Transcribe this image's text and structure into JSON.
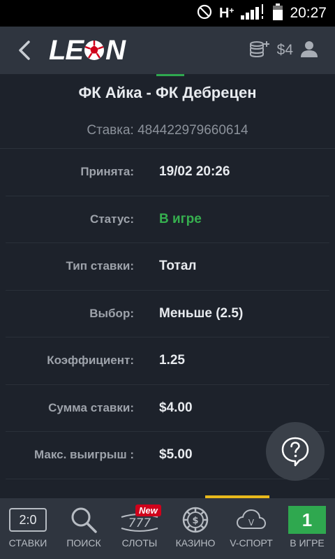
{
  "status_bar": {
    "network": "H",
    "network_plus": "+",
    "time": "20:27"
  },
  "header": {
    "logo_text_left": "LE",
    "logo_text_right": "N",
    "balance": "$4"
  },
  "match": {
    "title": "ФК Айка - ФК Дебрецен",
    "bet_label": "Ставка:",
    "bet_number": "484422979660614"
  },
  "details": [
    {
      "label": "Принята:",
      "value": "19/02 20:26",
      "status": "normal"
    },
    {
      "label": "Статус:",
      "value": "В игре",
      "status": "active"
    },
    {
      "label": "Тип ставки:",
      "value": "Тотал",
      "status": "normal"
    },
    {
      "label": "Выбор:",
      "value": "Меньше (2.5)",
      "status": "normal"
    },
    {
      "label": "Коэффициент:",
      "value": "1.25",
      "status": "normal"
    },
    {
      "label": "Сумма ставки:",
      "value": "$4.00",
      "status": "normal"
    },
    {
      "label": "Макс. выигрыш :",
      "value": "$5.00",
      "status": "normal"
    }
  ],
  "colors": {
    "accent_green": "#36b04f",
    "badge_red": "#d0021b",
    "highlight_yellow": "#e8b91c"
  },
  "nav": {
    "bets": {
      "icon_text": "2:0",
      "label": "СТАВКИ"
    },
    "search": {
      "label": "ПОИСК"
    },
    "slots": {
      "icon_text": "777",
      "badge": "New",
      "label": "СЛОТЫ"
    },
    "casino": {
      "label": "КАЗИНО"
    },
    "vsport": {
      "icon_text": "V",
      "label": "V-СПОРТ"
    },
    "live": {
      "icon_text": "1",
      "label": "В ИГРЕ"
    }
  }
}
